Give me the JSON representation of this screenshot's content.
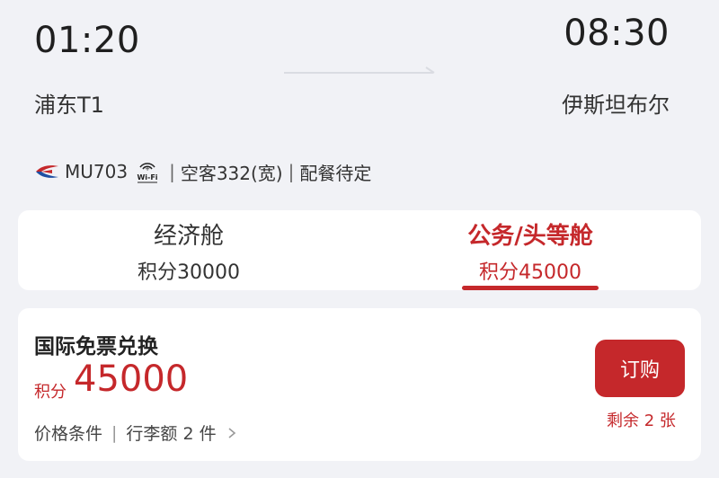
{
  "flight": {
    "departure_time": "01:20",
    "arrival_time": "08:30",
    "departure_airport": "浦东T1",
    "arrival_airport": "伊斯坦布尔",
    "flight_number": "MU703",
    "aircraft": "空客332(宽)",
    "meal": "配餐待定",
    "airline_icon": "china-eastern-logo",
    "wifi_icon": "wifi-icon"
  },
  "cabins": [
    {
      "name": "经济舱",
      "points": "积分30000",
      "selected": false
    },
    {
      "name": "公务/头等舱",
      "points": "积分45000",
      "selected": true
    }
  ],
  "offer": {
    "title": "国际免票兑换",
    "points_label": "积分",
    "points_value": "45000",
    "condition_1": "价格条件",
    "condition_2": "行李额 2 件",
    "book_label": "订购",
    "remaining": "剩余 2 张"
  },
  "colors": {
    "accent": "#c5282b",
    "background": "#f1f2f6",
    "card": "#ffffff"
  }
}
